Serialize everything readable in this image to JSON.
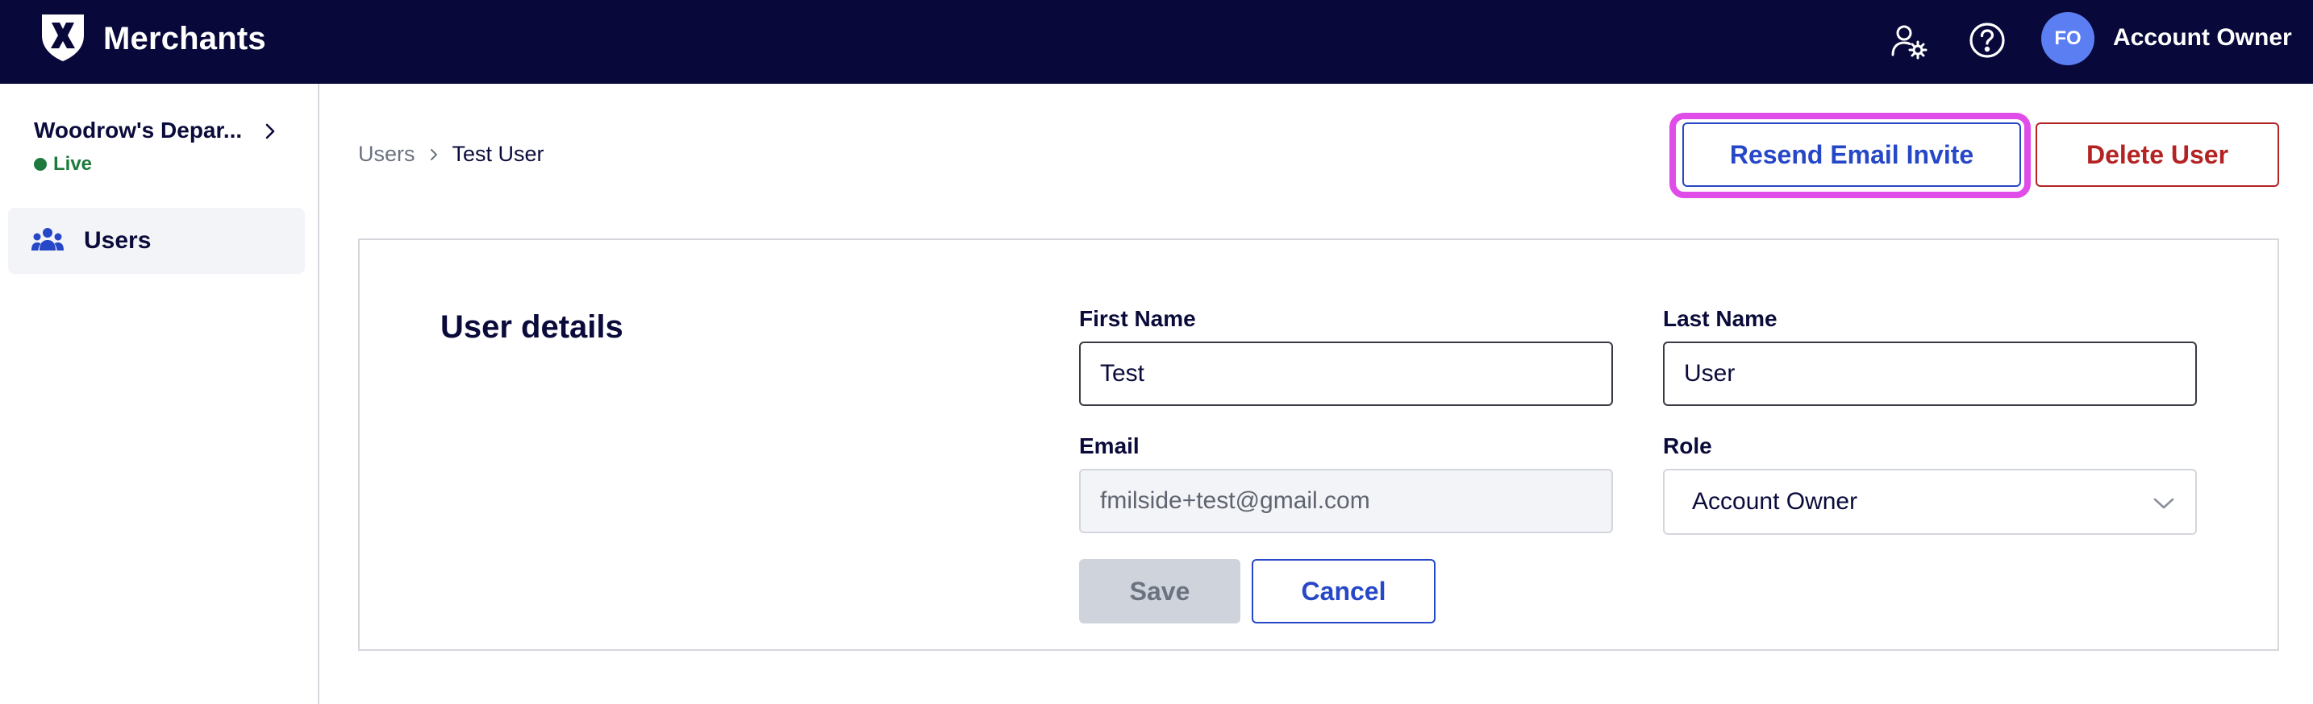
{
  "app": {
    "title": "Merchants",
    "logo_icon": "x-shield-logo"
  },
  "header": {
    "icons": [
      "user-settings-icon",
      "help-icon"
    ],
    "avatar_initials": "FO",
    "account_name": "Account Owner"
  },
  "sidebar": {
    "org_name": "Woodrow's Depar...",
    "org_status": "Live",
    "items": [
      {
        "label": "Users",
        "icon": "users-icon",
        "active": true
      }
    ]
  },
  "breadcrumb": {
    "parent": "Users",
    "current": "Test User"
  },
  "actions": {
    "resend_label": "Resend Email Invite",
    "delete_label": "Delete User"
  },
  "form": {
    "section_title": "User details",
    "first_name_label": "First Name",
    "first_name_value": "Test",
    "last_name_label": "Last Name",
    "last_name_value": "User",
    "email_label": "Email",
    "email_value": "fmilside+test@gmail.com",
    "role_label": "Role",
    "role_value": "Account Owner",
    "save_label": "Save",
    "cancel_label": "Cancel"
  },
  "colors": {
    "topbar": "#08083a",
    "primary": "#2647c7",
    "danger": "#b42323",
    "live": "#1e7a3c",
    "highlight": "#e04ce8",
    "avatar": "#5b7ff2"
  }
}
